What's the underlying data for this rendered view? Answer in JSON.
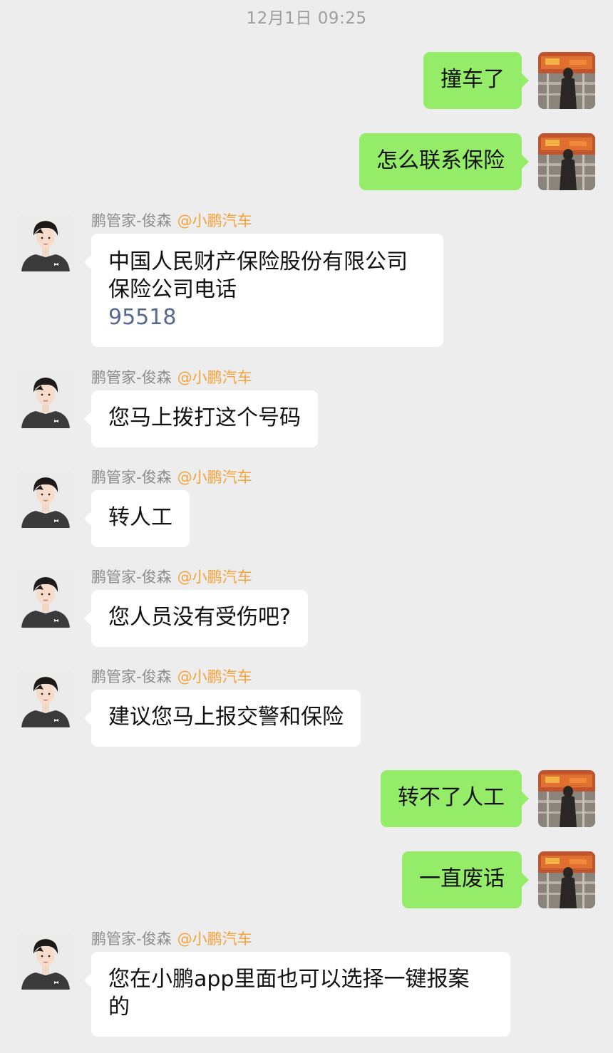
{
  "timestamp": "12月1日 09:25",
  "colors": {
    "background": "#ededed",
    "outgoing_bubble": "#95ec69",
    "incoming_bubble": "#ffffff",
    "org_tag": "#f4a33a",
    "link": "#57698f"
  },
  "sender": {
    "name": "鹏管家-俊森",
    "org": "@小鹏汽车"
  },
  "messages": [
    {
      "direction": "out",
      "text": "撞车了"
    },
    {
      "direction": "out",
      "text": "怎么联系保险"
    },
    {
      "direction": "in",
      "lines": [
        "中国人民财产保险股份有限公司",
        "保险公司电话"
      ],
      "phone": "95518"
    },
    {
      "direction": "in",
      "text": "您马上拨打这个号码"
    },
    {
      "direction": "in",
      "text": "转人工"
    },
    {
      "direction": "in",
      "text": "您人员没有受伤吧?"
    },
    {
      "direction": "in",
      "text": "建议您马上报交警和保险"
    },
    {
      "direction": "out",
      "text": "转不了人工"
    },
    {
      "direction": "out",
      "text": "一直废话"
    },
    {
      "direction": "in",
      "lines": [
        "您在小鹏app里面也可以选择一键报案",
        "的"
      ]
    }
  ]
}
